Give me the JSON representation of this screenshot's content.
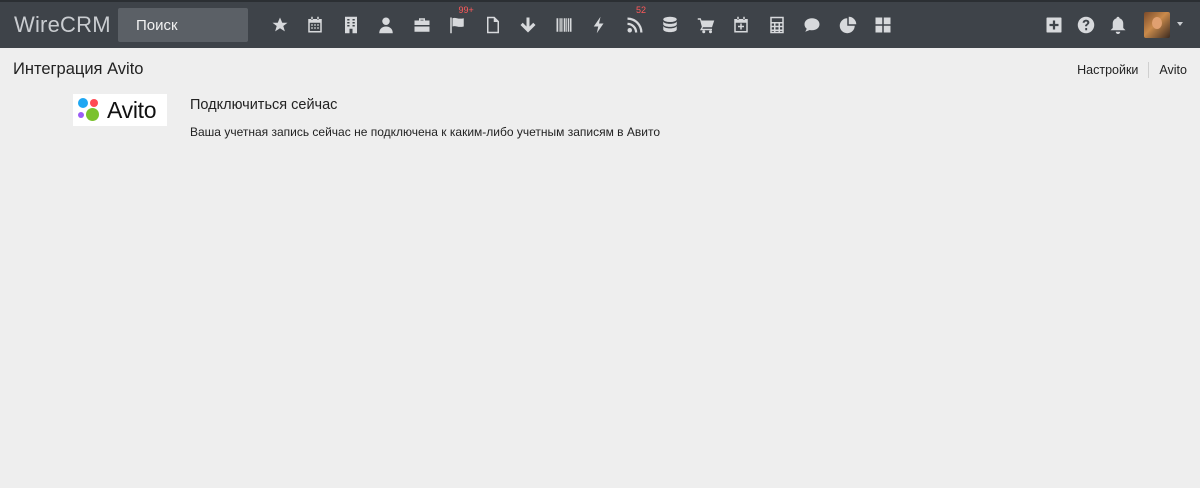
{
  "header": {
    "brand": "WireCRM",
    "search_placeholder": "Поиск",
    "nav_icons": [
      {
        "name": "star-icon"
      },
      {
        "name": "calendar-icon"
      },
      {
        "name": "building-icon"
      },
      {
        "name": "user-icon"
      },
      {
        "name": "briefcase-icon"
      },
      {
        "name": "flag-icon",
        "badge": "99+"
      },
      {
        "name": "document-icon"
      },
      {
        "name": "arrow-down-icon"
      },
      {
        "name": "barcode-icon"
      },
      {
        "name": "lightning-icon"
      },
      {
        "name": "rss-icon",
        "badge": "52"
      },
      {
        "name": "database-icon"
      },
      {
        "name": "cart-icon"
      },
      {
        "name": "calendar-add-icon"
      },
      {
        "name": "calculator-icon"
      },
      {
        "name": "chat-icon"
      },
      {
        "name": "pie-chart-icon"
      },
      {
        "name": "grid-icon"
      }
    ],
    "right_icons": [
      "plus-square-icon",
      "help-icon",
      "bell-icon"
    ],
    "badge_color": "#ff5a5a"
  },
  "page": {
    "title": "Интеграция Avito",
    "breadcrumb": [
      "Настройки",
      "Avito"
    ]
  },
  "integration": {
    "logo_text": "Avito",
    "connect_title": "Подключиться сейчас",
    "description": "Ваша учетная запись сейчас не подключена к каким-либо учетным записям в Авито"
  }
}
